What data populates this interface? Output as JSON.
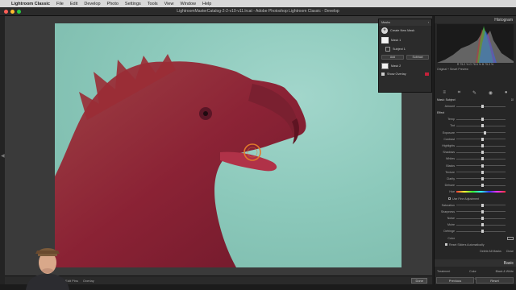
{
  "menubar": {
    "app": "Lightroom Classic",
    "items": [
      "File",
      "Edit",
      "Develop",
      "Photo",
      "Settings",
      "Tools",
      "View",
      "Window",
      "Help"
    ]
  },
  "window_title": "LightroomMasterCatalog-2-2-v10-v11.lrcat - Adobe Photoshop Lightroom Classic - Develop",
  "masks_panel": {
    "title": "Masks",
    "create_new": "Create New Mask",
    "mask1": "Mask 1",
    "subject": "Subject 1",
    "add": "Add",
    "subtract": "Subtract",
    "mask2": "Mask 2",
    "show_overlay": "Show Overlay"
  },
  "right_panel": {
    "histogram_title": "Histogram",
    "histo_readout": "R  75.2  %   G  78.6  %   B  75.3  %",
    "histo_sub": "Original + Smart Preview",
    "mask_label": "Mask: Subject",
    "effect": "Effect",
    "amount_label": "Amount",
    "sliders": [
      {
        "label": "Temp",
        "pos": 0.5
      },
      {
        "label": "Tint",
        "pos": 0.5
      },
      {
        "label": "Exposure",
        "pos": 0.55
      },
      {
        "label": "Contrast",
        "pos": 0.5
      },
      {
        "label": "Highlights",
        "pos": 0.5
      },
      {
        "label": "Shadows",
        "pos": 0.5
      },
      {
        "label": "Whites",
        "pos": 0.5
      },
      {
        "label": "Blacks",
        "pos": 0.5
      },
      {
        "label": "Texture",
        "pos": 0.5
      },
      {
        "label": "Clarity",
        "pos": 0.5
      },
      {
        "label": "Dehaze",
        "pos": 0.5
      }
    ],
    "hue_label": "Hue",
    "use_fine": "Use Fine Adjustment",
    "sliders2": [
      {
        "label": "Saturation",
        "pos": 0.5
      },
      {
        "label": "Sharpness",
        "pos": 0.5
      },
      {
        "label": "Noise",
        "pos": 0.5
      },
      {
        "label": "Moire",
        "pos": 0.5
      },
      {
        "label": "Defringe",
        "pos": 0.5
      }
    ],
    "color_label": "Color",
    "reset_sliders": "Reset Sliders Automatically",
    "delete_all": "Delete All Masks",
    "close": "Close",
    "basic": "Basic",
    "treatment": "Treatment",
    "color": "Color",
    "bw": "Black & White",
    "profile": "Profile",
    "profile_val": "Color",
    "wb": "WB",
    "as_shot": "As Shot",
    "previous": "Previous",
    "reset": "Reset"
  },
  "toolbar": {
    "show_edit_pins": "Show Edit Pins",
    "overlay": "Overlay",
    "done": "Done"
  },
  "colors": {
    "mask_overlay": "#8b1a2e",
    "background_sky": "#8cc9bb"
  }
}
